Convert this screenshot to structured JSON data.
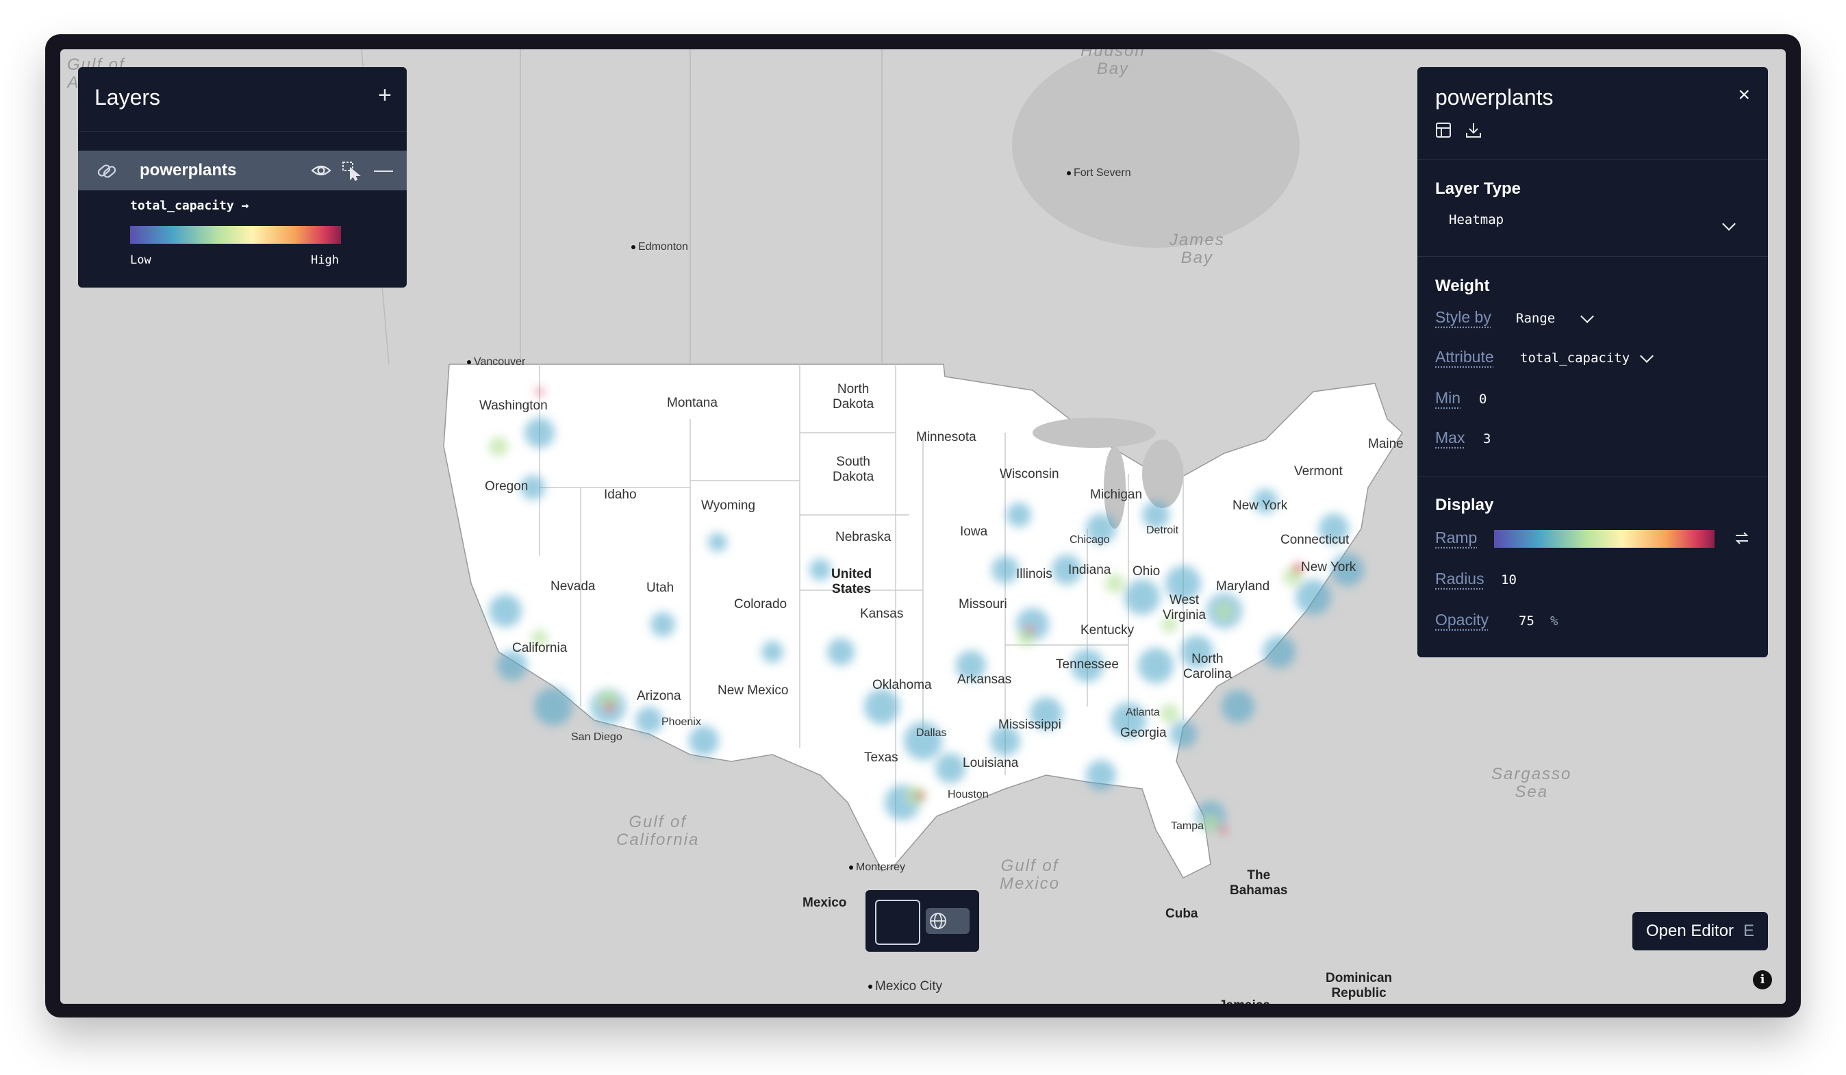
{
  "layers_panel": {
    "title": "Layers",
    "add_label": "+",
    "layer": {
      "name": "powerplants",
      "legend_attribute": "total_capacity →",
      "legend_low": "Low",
      "legend_high": "High"
    }
  },
  "properties_panel": {
    "title": "powerplants",
    "close_label": "×",
    "layer_type_heading": "Layer Type",
    "layer_type_value": "Heatmap",
    "weight_heading": "Weight",
    "style_by_label": "Style by",
    "style_by_value": "Range",
    "attribute_label": "Attribute",
    "attribute_value": "total_capacity",
    "min_label": "Min",
    "min_value": "0",
    "max_label": "Max",
    "max_value": "3",
    "display_heading": "Display",
    "ramp_label": "Ramp",
    "radius_label": "Radius",
    "radius_value": "10",
    "opacity_label": "Opacity",
    "opacity_value": "75",
    "opacity_unit": "%"
  },
  "open_editor": {
    "label": "Open Editor",
    "shortcut": "E"
  },
  "colors": {
    "panel_bg": "#141a2c",
    "accent_label": "#7d90b5",
    "map_land_us": "#ffffff",
    "map_land_other": "#d2d2d2",
    "ramp": [
      "#5a4fb0",
      "#4aa3c7",
      "#b9e3a0",
      "#fff3b0",
      "#f6a45a",
      "#d63d5c",
      "#8b1f4a"
    ]
  },
  "map": {
    "water_labels": [
      "Hudson Bay",
      "James Bay",
      "Gulf of California",
      "Gulf of Mexico",
      "Sargasso Sea",
      "Gulf of Alaska"
    ],
    "state_labels": [
      "Washington",
      "Oregon",
      "California",
      "Nevada",
      "Idaho",
      "Montana",
      "Wyoming",
      "Utah",
      "Colorado",
      "Arizona",
      "New Mexico",
      "North Dakota",
      "South Dakota",
      "Nebraska",
      "Kansas",
      "Oklahoma",
      "Texas",
      "Minnesota",
      "Iowa",
      "Missouri",
      "Arkansas",
      "Louisiana",
      "Wisconsin",
      "Illinois",
      "Mississippi",
      "Michigan",
      "Indiana",
      "Kentucky",
      "Tennessee",
      "Ohio",
      "Georgia",
      "West Virginia",
      "Virginia",
      "North Carolina",
      "Maryland",
      "New York",
      "Vermont",
      "Maine",
      "Connecticut"
    ],
    "city_labels": [
      "Edmonton",
      "Vancouver",
      "Fort Severn",
      "Chicago",
      "Detroit",
      "New York",
      "Atlanta",
      "Dallas",
      "Houston",
      "Phoenix",
      "San Diego",
      "Tampa",
      "Monterrey",
      "Mexico City"
    ],
    "country_labels": [
      "United States",
      "Mexico",
      "Cuba",
      "The Bahamas",
      "Dominican Republic",
      "Jamaica"
    ]
  }
}
